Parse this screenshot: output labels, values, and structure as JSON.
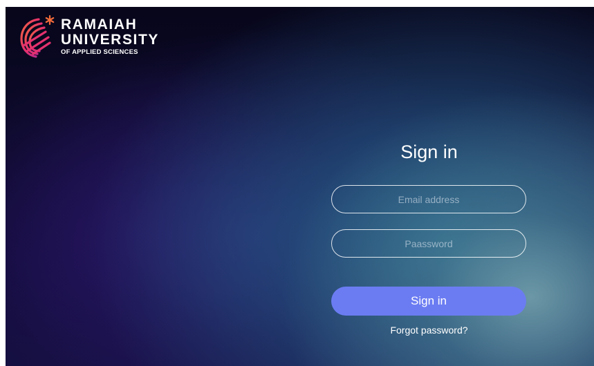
{
  "brand": {
    "line1": "RAMAIAH",
    "line2": "UNIVERSITY",
    "line3": "OF APPLIED SCIENCES",
    "logo_icon": "ramaiah-logo-icon",
    "logo_colors": [
      "#f26b3a",
      "#e6306e",
      "#b52a8e"
    ]
  },
  "signin": {
    "title": "Sign in",
    "email_placeholder": "Email address",
    "password_placeholder": "Paassword",
    "button_label": "Sign in",
    "forgot_label": "Forgot password?"
  },
  "colors": {
    "button": "#6b7cf2",
    "text": "#ffffff"
  }
}
